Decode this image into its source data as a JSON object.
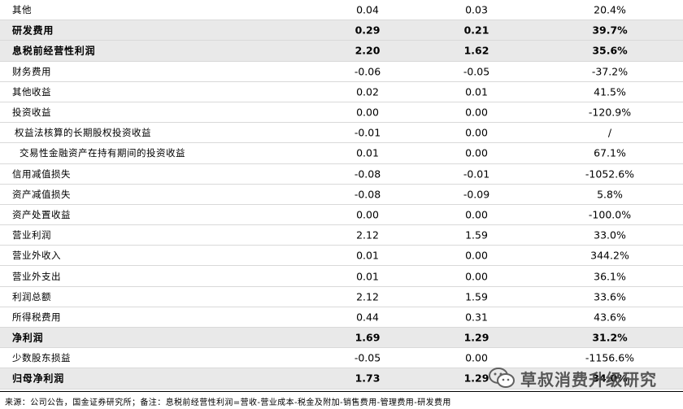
{
  "rows": [
    {
      "name": "其他",
      "v1": "0.04",
      "v2": "0.03",
      "v3": "20.4%",
      "bold": false,
      "indent": 0
    },
    {
      "name": "研发费用",
      "v1": "0.29",
      "v2": "0.21",
      "v3": "39.7%",
      "bold": true,
      "indent": 0
    },
    {
      "name": "息税前经营性利润",
      "v1": "2.20",
      "v2": "1.62",
      "v3": "35.6%",
      "bold": true,
      "indent": 0
    },
    {
      "name": "财务费用",
      "v1": "-0.06",
      "v2": "-0.05",
      "v3": "-37.2%",
      "bold": false,
      "indent": 0
    },
    {
      "name": "其他收益",
      "v1": "0.02",
      "v2": "0.01",
      "v3": "41.5%",
      "bold": false,
      "indent": 0
    },
    {
      "name": "投资收益",
      "v1": "0.00",
      "v2": "0.00",
      "v3": "-120.9%",
      "bold": false,
      "indent": 0
    },
    {
      "name": "权益法核算的长期股权投资收益",
      "v1": "-0.01",
      "v2": "0.00",
      "v3": "/",
      "bold": false,
      "indent": 1
    },
    {
      "name": "交易性金融资产在持有期间的投资收益",
      "v1": "0.01",
      "v2": "0.00",
      "v3": "67.1%",
      "bold": false,
      "indent": 2
    },
    {
      "name": "信用减值损失",
      "v1": "-0.08",
      "v2": "-0.01",
      "v3": "-1052.6%",
      "bold": false,
      "indent": 0
    },
    {
      "name": "资产减值损失",
      "v1": "-0.08",
      "v2": "-0.09",
      "v3": "5.8%",
      "bold": false,
      "indent": 0
    },
    {
      "name": "资产处置收益",
      "v1": "0.00",
      "v2": "0.00",
      "v3": "-100.0%",
      "bold": false,
      "indent": 0
    },
    {
      "name": "营业利润",
      "v1": "2.12",
      "v2": "1.59",
      "v3": "33.0%",
      "bold": false,
      "indent": 0
    },
    {
      "name": "营业外收入",
      "v1": "0.01",
      "v2": "0.00",
      "v3": "344.2%",
      "bold": false,
      "indent": 0
    },
    {
      "name": "营业外支出",
      "v1": "0.01",
      "v2": "0.00",
      "v3": "36.1%",
      "bold": false,
      "indent": 0
    },
    {
      "name": "利润总额",
      "v1": "2.12",
      "v2": "1.59",
      "v3": "33.6%",
      "bold": false,
      "indent": 0
    },
    {
      "name": "所得税费用",
      "v1": "0.44",
      "v2": "0.31",
      "v3": "43.6%",
      "bold": false,
      "indent": 0
    },
    {
      "name": "净利润",
      "v1": "1.69",
      "v2": "1.29",
      "v3": "31.2%",
      "bold": true,
      "indent": 0
    },
    {
      "name": "少数股东损益",
      "v1": "-0.05",
      "v2": "0.00",
      "v3": "-1156.6%",
      "bold": false,
      "indent": 0
    },
    {
      "name": "归母净利润",
      "v1": "1.73",
      "v2": "1.29",
      "v3": "34.0%",
      "bold": true,
      "indent": 0
    }
  ],
  "footer": "来源：公司公告，国金证券研究所；备注：息税前经营性利润=营收-营业成本-税金及附加-销售费用-管理费用-研发费用",
  "watermark": {
    "text": "草叔消费升级研究",
    "icon": "wechat-icon"
  }
}
